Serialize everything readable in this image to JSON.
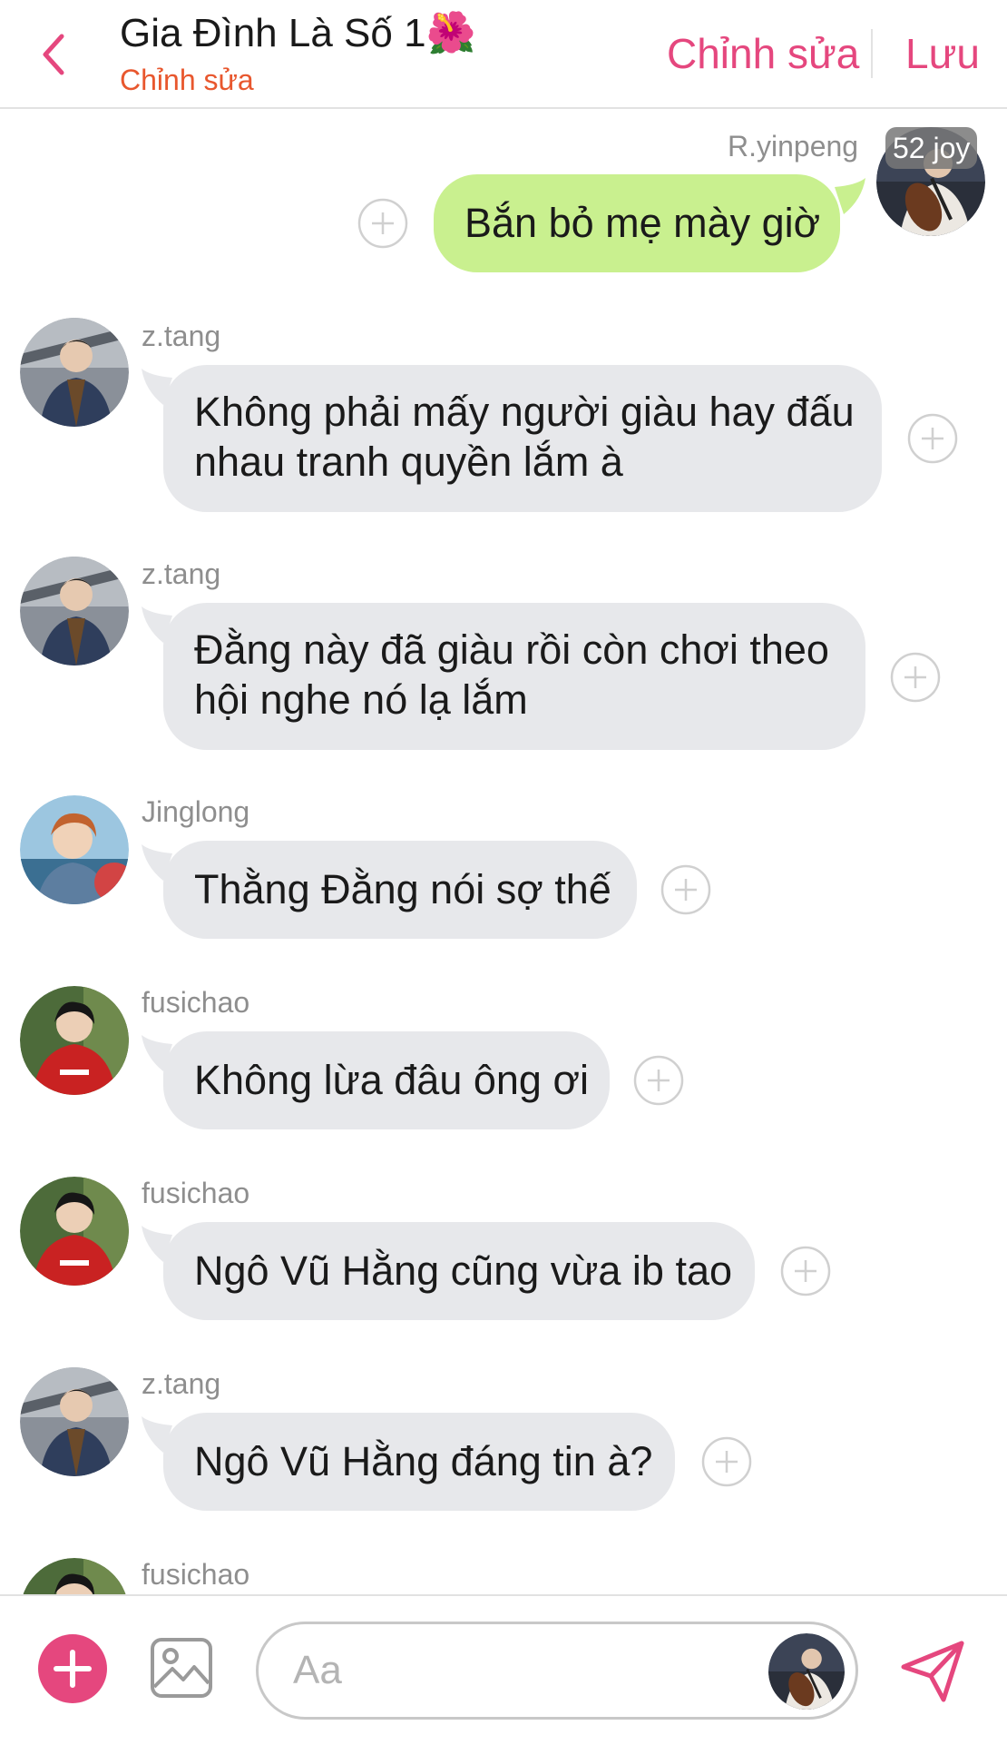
{
  "header": {
    "title": "Gia Đình Là Số 1",
    "title_emoji": "🌺",
    "subtitle": "Chỉnh sửa",
    "edit_label": "Chỉnh sửa",
    "save_label": "Lưu"
  },
  "messages": [
    {
      "sender": "R.yinpeng",
      "badge": "52 joy",
      "lines": [
        "Bắn bỏ mẹ mày giờ"
      ]
    },
    {
      "sender": "z.tang",
      "lines": [
        "Không phải mấy người giàu hay đấu",
        "nhau tranh quyền lắm à"
      ]
    },
    {
      "sender": "z.tang",
      "lines": [
        "Đằng này đã giàu rồi còn chơi theo",
        "hội nghe nó lạ lắm"
      ]
    },
    {
      "sender": "Jinglong",
      "lines": [
        "Thằng Đằng nói sợ thế"
      ]
    },
    {
      "sender": "fusichao",
      "lines": [
        "Không lừa đâu ông ơi"
      ]
    },
    {
      "sender": "fusichao",
      "lines": [
        "Ngô Vũ Hằng cũng vừa ib tao"
      ]
    },
    {
      "sender": "z.tang",
      "lines": [
        "Ngô Vũ Hằng đáng tin à?"
      ]
    },
    {
      "sender": "fusichao",
      "lines": []
    }
  ],
  "composer": {
    "placeholder": "Aa"
  },
  "colors": {
    "accent": "#e5477e",
    "subtitle": "#e8572e",
    "bubble_in": "#e7e8eb",
    "bubble_out": "#c9f08f"
  },
  "icons": [
    "chevron-left-icon",
    "plus-circle-icon",
    "plus-icon",
    "image-icon",
    "send-icon"
  ]
}
